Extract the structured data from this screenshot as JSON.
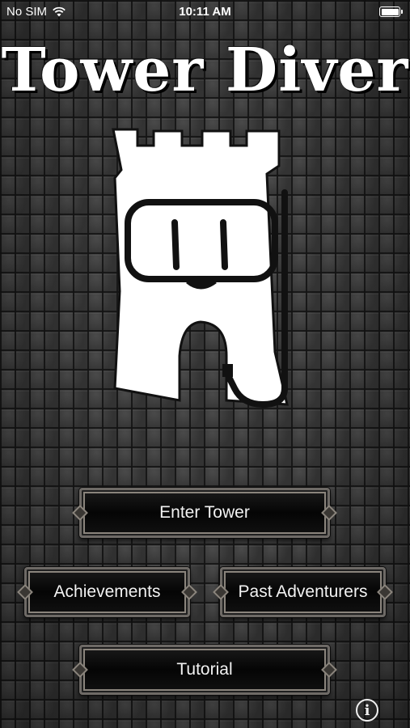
{
  "status_bar": {
    "carrier": "No SIM",
    "time": "10:11 AM",
    "wifi_icon": "wifi-icon",
    "battery_icon": "battery-icon",
    "battery_level": 1.0
  },
  "title": "Tower Diver",
  "logo": {
    "icon": "tower-diver-logo",
    "colors": {
      "fill": "#ffffff",
      "stroke": "#111111"
    }
  },
  "menu": {
    "enter_tower": "Enter Tower",
    "achievements": "Achievements",
    "past_adventurers": "Past Adventurers",
    "tutorial": "Tutorial"
  },
  "info_button": {
    "icon": "info-icon",
    "label": "i"
  },
  "colors": {
    "background": "#3a3a3a",
    "button_fill": "#0a0a0a",
    "button_border": "#8a847c",
    "text": "#f2f2f2"
  }
}
